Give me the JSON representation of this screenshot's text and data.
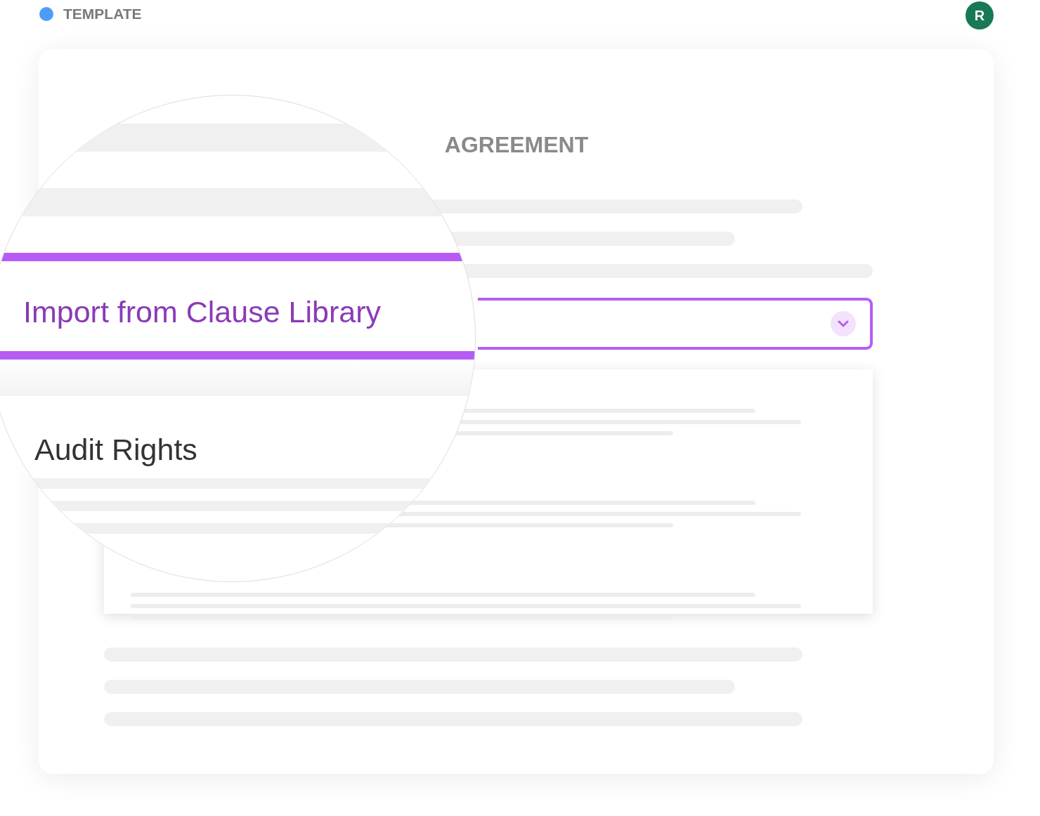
{
  "header": {
    "label": "TEMPLATE",
    "avatar": "R"
  },
  "document": {
    "title": "AGREEMENT",
    "dropdown": {
      "expanded": true
    }
  },
  "magnifier": {
    "dropdown_label": "Import from Clause Library",
    "option": "Audit Rights"
  }
}
